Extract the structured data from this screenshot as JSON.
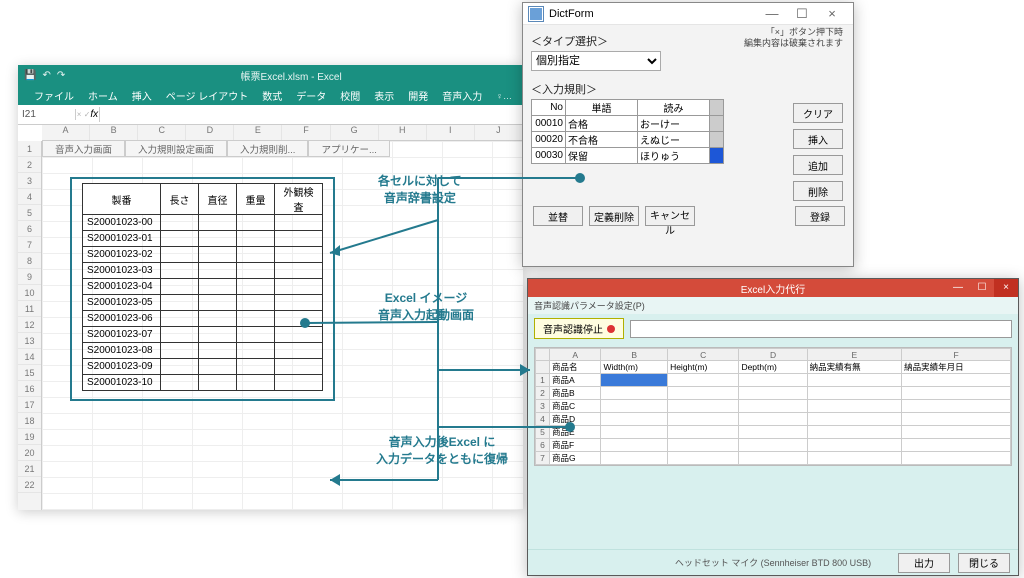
{
  "excel": {
    "title": "帳票Excel.xlsm - Excel",
    "tabs": [
      "ファイル",
      "ホーム",
      "挿入",
      "ページ レイアウト",
      "数式",
      "データ",
      "校閲",
      "表示",
      "開発",
      "音声入力"
    ],
    "tellme": "♀ 実行したい作業を入力してください...",
    "namebox": "I21",
    "fx": "fx",
    "sheet_tabs": [
      "音声入力画面",
      "入力規則設定画面",
      "入力規則削...",
      "アプリケー..."
    ],
    "col_letters": [
      "A",
      "B",
      "C",
      "D",
      "E",
      "F",
      "G",
      "H",
      "I",
      "J"
    ],
    "row_nums": [
      "1",
      "2",
      "3",
      "4",
      "5",
      "6",
      "7",
      "8",
      "9",
      "10",
      "11",
      "12",
      "13",
      "14",
      "15",
      "16",
      "17",
      "18",
      "19",
      "20",
      "21",
      "22"
    ],
    "table": {
      "headers": [
        "製番",
        "長さ",
        "直径",
        "重量",
        "外観検査"
      ],
      "rows": [
        [
          "S20001023-00",
          "",
          "",
          "",
          ""
        ],
        [
          "S20001023-01",
          "",
          "",
          "",
          ""
        ],
        [
          "S20001023-02",
          "",
          "",
          "",
          ""
        ],
        [
          "S20001023-03",
          "",
          "",
          "",
          ""
        ],
        [
          "S20001023-04",
          "",
          "",
          "",
          ""
        ],
        [
          "S20001023-05",
          "",
          "",
          "",
          ""
        ],
        [
          "S20001023-06",
          "",
          "",
          "",
          ""
        ],
        [
          "S20001023-07",
          "",
          "",
          "",
          ""
        ],
        [
          "S20001023-08",
          "",
          "",
          "",
          ""
        ],
        [
          "S20001023-09",
          "",
          "",
          "",
          ""
        ],
        [
          "S20001023-10",
          "",
          "",
          "",
          ""
        ]
      ]
    }
  },
  "dict": {
    "title": "DictForm",
    "warn_l1": "「×」ボタン押下時",
    "warn_l2": "編集内容は破棄されます",
    "h_type": "＜タイプ選択＞",
    "type_value": "個別指定",
    "h_rule": "＜入力規則＞",
    "table": {
      "headers": [
        "No",
        "単語",
        "読み"
      ],
      "rows": [
        {
          "no": "00010",
          "word": "合格",
          "yomi": "おーけー",
          "sel": false
        },
        {
          "no": "00020",
          "word": "不合格",
          "yomi": "えぬじー",
          "sel": false
        },
        {
          "no": "00030",
          "word": "保留",
          "yomi": "ほりゅう",
          "sel": true
        }
      ]
    },
    "side_btns": [
      "クリア",
      "挿入",
      "追加",
      "削除"
    ],
    "bottom_btns": [
      "並替",
      "定義削除",
      "キャンセル",
      "登録"
    ]
  },
  "proxy": {
    "title": "Excel入力代行",
    "menu": "音声認識パラメータ設定(P)",
    "stop_btn": "音声認識停止",
    "cols": [
      "",
      "A",
      "B",
      "C",
      "D",
      "E",
      "F"
    ],
    "headers": [
      "",
      "商品名",
      "Width(m)",
      "Height(m)",
      "Depth(m)",
      "納品実績有無",
      "納品実績年月日"
    ],
    "rows": [
      [
        "1",
        "商品A",
        "",
        "",
        "",
        "",
        ""
      ],
      [
        "2",
        "商品B",
        "",
        "",
        "",
        "",
        ""
      ],
      [
        "3",
        "商品C",
        "",
        "",
        "",
        "",
        ""
      ],
      [
        "4",
        "商品D",
        "",
        "",
        "",
        "",
        ""
      ],
      [
        "5",
        "商品E",
        "",
        "",
        "",
        "",
        ""
      ],
      [
        "6",
        "商品F",
        "",
        "",
        "",
        "",
        ""
      ],
      [
        "7",
        "商品G",
        "",
        "",
        "",
        "",
        ""
      ]
    ],
    "sel_cell": {
      "r": 1,
      "c": 2
    },
    "status": "ヘッドセット マイク (Sennheiser BTD 800 USB)",
    "btn_out": "出力",
    "btn_close": "閉じる"
  },
  "anno": {
    "a1_l1": "各セルに対して",
    "a1_l2": "音声辞書設定",
    "a2_l1": "Excel イメージ",
    "a2_l2": "音声入力起動画面",
    "a3_l1": "音声入力後Excel に",
    "a3_l2": "入力データをともに復帰"
  }
}
